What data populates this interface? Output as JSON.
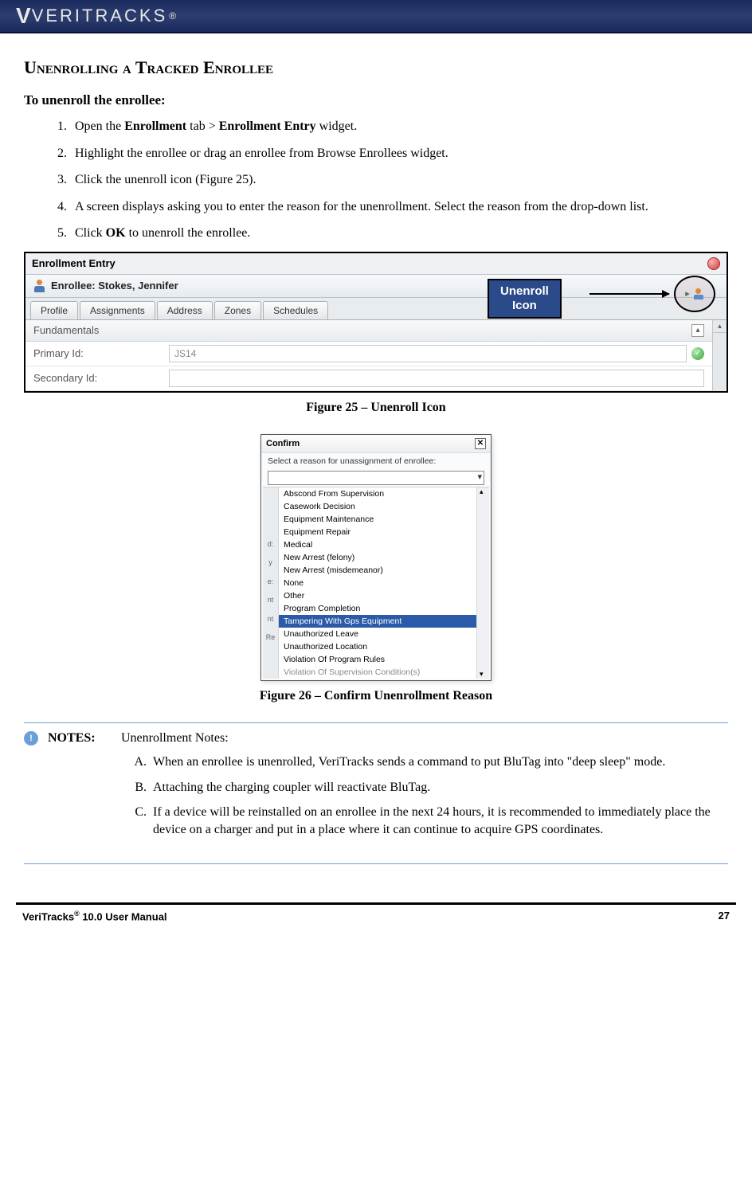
{
  "header": {
    "logo": "VERITRACKS",
    "reg": "®"
  },
  "section_title": "Unenrolling a Tracked Enrollee",
  "subhead": "To unenroll the enrollee:",
  "steps": {
    "s1a": "Open the ",
    "s1b": "Enrollment",
    "s1c": " tab > ",
    "s1d": "Enrollment Entry",
    "s1e": " widget.",
    "s2": "Highlight the enrollee or drag an enrollee from Browse Enrollees widget.",
    "s3": "Click the unenroll icon (Figure 25).",
    "s4": "A screen displays asking you to enter the reason for the unenrollment. Select the reason from the drop-down list.",
    "s5a": "Click ",
    "s5b": "OK",
    "s5c": " to unenroll the enrollee."
  },
  "fig25": {
    "widget_title": "Enrollment Entry",
    "enrollee_label": "Enrollee: Stokes, Jennifer",
    "tabs": {
      "t1": "Profile",
      "t2": "Assignments",
      "t3": "Address",
      "t4": "Zones",
      "t5": "Schedules"
    },
    "section": "Fundamentals",
    "primary_label": "Primary Id:",
    "primary_value": "JS14",
    "secondary_label": "Secondary Id:",
    "callout_l1": "Unenroll",
    "callout_l2": "Icon",
    "collapse_glyph": "▴",
    "caption": "Figure 25 – Unenroll Icon"
  },
  "fig26": {
    "title": "Confirm",
    "prompt": "Select a reason for unassignment of enrollee:",
    "left": {
      "a": "d:",
      "b": "y",
      "c": "e:",
      "d": "nt",
      "e": "nt",
      "f": "Re"
    },
    "options": {
      "o1": "Abscond From Supervision",
      "o2": "Casework Decision",
      "o3": "Equipment Maintenance",
      "o4": "Equipment Repair",
      "o5": "Medical",
      "o6": "New Arrest (felony)",
      "o7": "New Arrest (misdemeanor)",
      "o8": "None",
      "o9": "Other",
      "o10": "Program Completion",
      "o11": "Tampering With Gps Equipment",
      "o12": "Unauthorized Leave",
      "o13": "Unauthorized Location",
      "o14": "Violation Of Program Rules",
      "o15": "Violation Of Supervision Condition(s)"
    },
    "caption": "Figure 26 – Confirm Unenrollment Reason"
  },
  "notes": {
    "label": "NOTES:",
    "intro": "Unenrollment Notes:",
    "a": "When an enrollee is unenrolled, VeriTracks sends a command to put BluTag into \"deep sleep\" mode.",
    "b": "Attaching the charging coupler will reactivate BluTag.",
    "c": "If a device will be reinstalled on an enrollee in the next 24 hours, it is recommended to immediately place the device on a charger and put in a place where it can continue to acquire GPS coordinates."
  },
  "footer": {
    "left_a": "VeriTracks",
    "left_sup": "®",
    "left_b": " 10.0 User Manual",
    "page": "27"
  }
}
